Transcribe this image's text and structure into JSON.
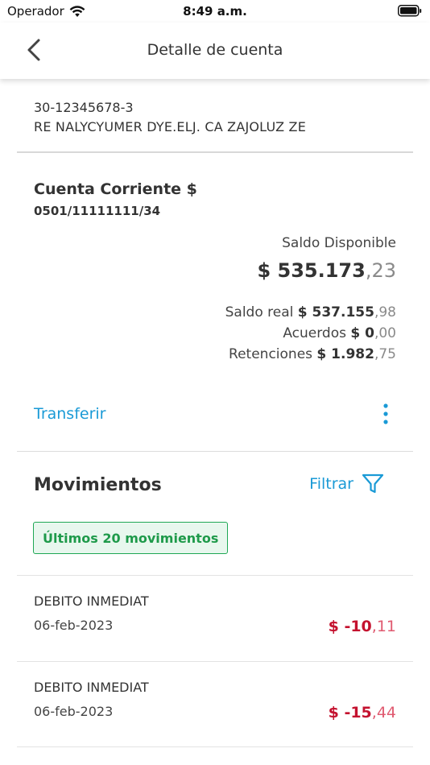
{
  "status_bar": {
    "carrier": "Operador",
    "time": "8:49 a.m."
  },
  "header": {
    "title": "Detalle de cuenta",
    "back_icon": "chevron-left-icon"
  },
  "holder": {
    "cuit": "30-12345678-3",
    "name": "RE NALYCYUMER DYE.ELJ. CA ZAJOLUZ ZE"
  },
  "account": {
    "type": "Cuenta Corriente $",
    "number": "0501/11111111/34",
    "available_label": "Saldo Disponible",
    "available_int": "$ 535.173",
    "available_dec": ",23",
    "lines": [
      {
        "label": "Saldo real",
        "int": "$ 537.155",
        "dec": ",98"
      },
      {
        "label": "Acuerdos",
        "int": "$ 0",
        "dec": ",00"
      },
      {
        "label": "Retenciones",
        "int": "$ 1.982",
        "dec": ",75"
      }
    ],
    "transfer_label": "Transferir"
  },
  "movements": {
    "title": "Movimientos",
    "filter_label": "Filtrar",
    "badge": "Últimos 20 movimientos",
    "items": [
      {
        "description": "DEBITO INMEDIAT",
        "date": "06-feb-2023",
        "amount_int": "$ -10",
        "amount_dec": ",11"
      },
      {
        "description": "DEBITO INMEDIAT",
        "date": "06-feb-2023",
        "amount_int": "$ -15",
        "amount_dec": ",44"
      }
    ]
  },
  "colors": {
    "link": "#1a9ad6",
    "negative_amount": "#c4122f",
    "badge_green": "#1fa855"
  }
}
